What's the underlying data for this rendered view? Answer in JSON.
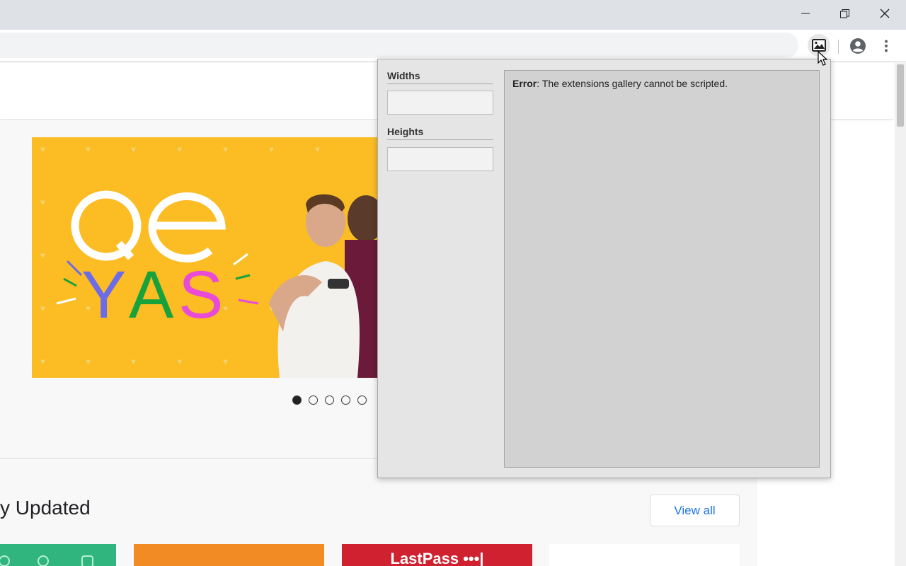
{
  "window": {
    "controls": {
      "minimize_icon": "minimize-icon",
      "restore_icon": "restore-icon",
      "close_icon": "close-icon"
    }
  },
  "toolbar": {
    "extension_icon": "image-icon",
    "profile_icon": "account-icon",
    "menu_icon": "more-vert-icon"
  },
  "page": {
    "carousel": {
      "logo_top": "QE",
      "logo_bottom": [
        "Y",
        "A",
        "S"
      ],
      "slide_count": 5,
      "active_slide": 1
    },
    "section_title": "y Updated",
    "view_all_label": "View all",
    "tiles": [
      {
        "color": "#30b57e"
      },
      {
        "color": "#f28b24"
      },
      {
        "color": "#cf2130",
        "label": "LastPass •••|"
      },
      {
        "color": "#ffffff"
      }
    ]
  },
  "popup": {
    "widths_label": "Widths",
    "widths_value": "",
    "heights_label": "Heights",
    "heights_value": "",
    "error_prefix": "Error",
    "error_message": ": The extensions gallery cannot be scripted."
  },
  "colors": {
    "titlebar": "#dee1e6",
    "accent_blue": "#1a73e8",
    "banner_yellow": "#fbbc24",
    "popup_bg": "#e5e5e5",
    "preview_bg": "#d2d2d2"
  }
}
